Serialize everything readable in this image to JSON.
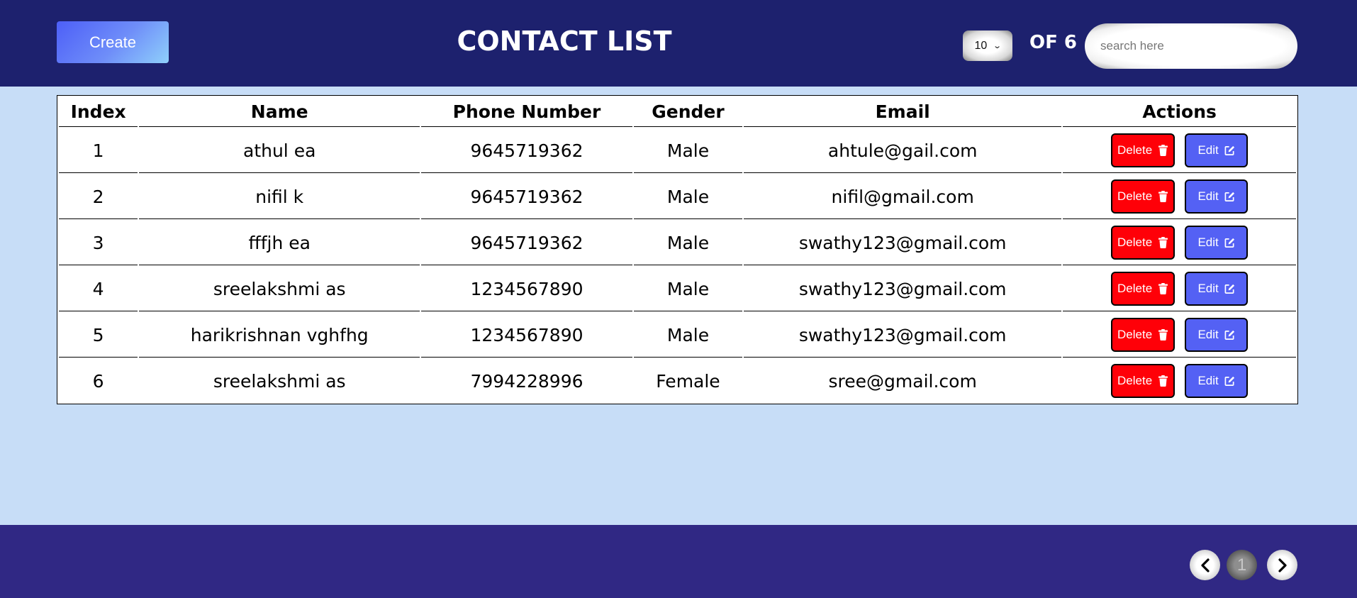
{
  "header": {
    "create_label": "Create",
    "title": "CONTACT LIST",
    "page_size": "10",
    "total_label": "OF 6",
    "search_placeholder": "search here",
    "search_value": ""
  },
  "table": {
    "columns": [
      "Index",
      "Name",
      "Phone Number",
      "Gender",
      "Email",
      "Actions"
    ],
    "delete_label": "Delete",
    "edit_label": "Edit",
    "rows": [
      {
        "index": "1",
        "name": "athul ea",
        "phone": "9645719362",
        "gender": "Male",
        "email": "ahtule@gail.com"
      },
      {
        "index": "2",
        "name": "nifil k",
        "phone": "9645719362",
        "gender": "Male",
        "email": "nifil@gmail.com"
      },
      {
        "index": "3",
        "name": "fffjh ea",
        "phone": "9645719362",
        "gender": "Male",
        "email": "swathy123@gmail.com"
      },
      {
        "index": "4",
        "name": "sreelakshmi as",
        "phone": "1234567890",
        "gender": "Male",
        "email": "swathy123@gmail.com"
      },
      {
        "index": "5",
        "name": "harikrishnan vghfhg",
        "phone": "1234567890",
        "gender": "Male",
        "email": "swathy123@gmail.com"
      },
      {
        "index": "6",
        "name": "sreelakshmi as",
        "phone": "7994228996",
        "gender": "Female",
        "email": "sree@gmail.com"
      }
    ]
  },
  "pagination": {
    "current_page": "1",
    "prev_icon": "chevron-left-icon",
    "next_icon": "chevron-right-icon"
  },
  "colors": {
    "header_bg": "#1d216e",
    "body_bg": "#c7ddf7",
    "footer_bg": "#302884",
    "delete_bg": "#ff0008",
    "edit_bg": "#5461f4",
    "create_gradient_start": "#4d5ff8",
    "create_gradient_end": "#8fd0fb"
  }
}
